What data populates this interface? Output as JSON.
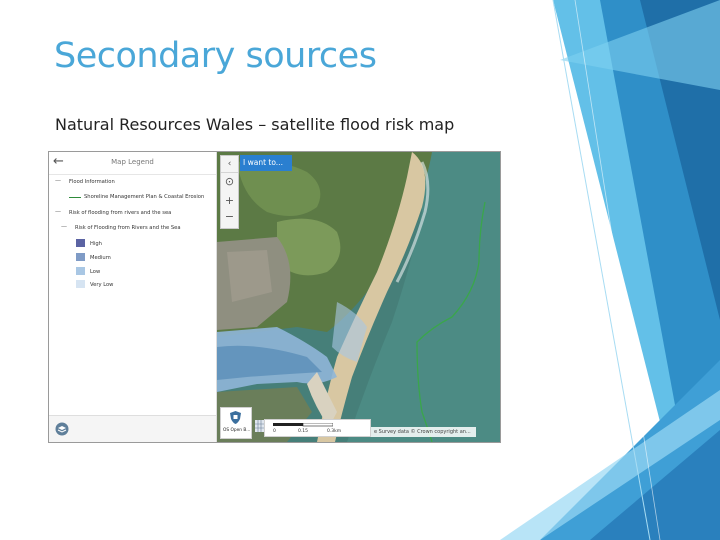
{
  "slide": {
    "title": "Secondary sources",
    "subtitle": "Natural Resources Wales – satellite flood risk map"
  },
  "legend_panel": {
    "header": "Map Legend",
    "back_icon": "left-arrow-icon",
    "collapse_icon": "chevron-left-icon",
    "groups": [
      {
        "label": "Flood Information",
        "child": "Shoreline Management Plan & Coastal Erosion"
      },
      {
        "label": "Risk of flooding from rivers and the sea",
        "child": "Risk of Flooding from Rivers and the Sea"
      }
    ],
    "risk_levels": [
      {
        "label": "High",
        "color": "#5b63a3"
      },
      {
        "label": "Medium",
        "color": "#7f9bc6"
      },
      {
        "label": "Low",
        "color": "#a9c7e4"
      },
      {
        "label": "Very Low",
        "color": "#d6e4f2"
      }
    ],
    "shoreline_color": "#2e8b3a"
  },
  "map_controls": {
    "i_want_to": "I want to...",
    "tools": [
      "locate-icon",
      "zoom-in-icon",
      "zoom-out-icon"
    ],
    "basemap_label": "OS Open B...",
    "scale_labels": [
      "0",
      "0.15",
      "0.3km"
    ],
    "attribution": "e Survey data © Crown copyright an..."
  },
  "colors": {
    "accent": "#4aa7d8",
    "i_want_button": "#2a7fd0",
    "sea": "#4b8a80",
    "flood_zone": "#8fb6d8"
  }
}
